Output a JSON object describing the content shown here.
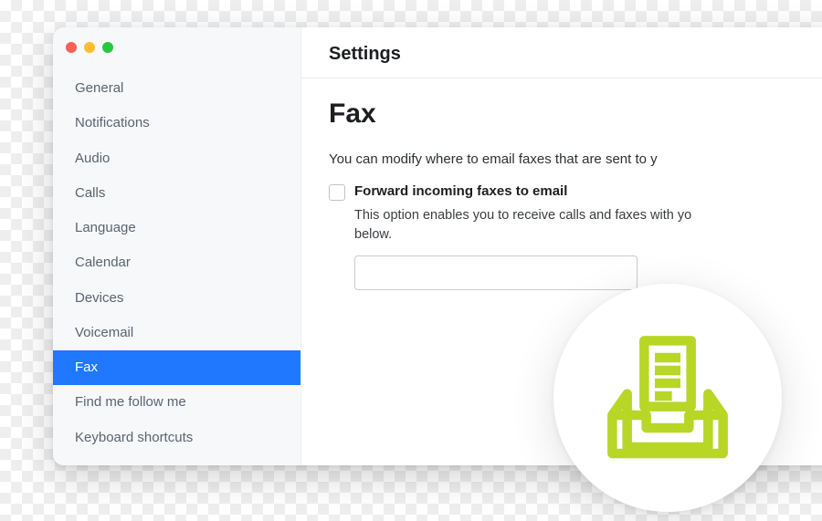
{
  "header": {
    "title": "Settings"
  },
  "sidebar": {
    "items": [
      {
        "label": "General",
        "selected": false
      },
      {
        "label": "Notifications",
        "selected": false
      },
      {
        "label": "Audio",
        "selected": false
      },
      {
        "label": "Calls",
        "selected": false
      },
      {
        "label": "Language",
        "selected": false
      },
      {
        "label": "Calendar",
        "selected": false
      },
      {
        "label": "Devices",
        "selected": false
      },
      {
        "label": "Voicemail",
        "selected": false
      },
      {
        "label": "Fax",
        "selected": true
      },
      {
        "label": "Find me follow me",
        "selected": false
      },
      {
        "label": "Keyboard shortcuts",
        "selected": false
      }
    ]
  },
  "main": {
    "section_title": "Fax",
    "intro_text": "You can modify where to email faxes that are sent to y",
    "checkbox_label": "Forward incoming faxes to email",
    "checkbox_checked": false,
    "option_description_line1": "This option enables you to receive calls and faxes with yo",
    "option_description_line2": "below.",
    "email_value": ""
  },
  "badge": {
    "icon_name": "fax-inbox-icon",
    "color": "#b8d626"
  }
}
